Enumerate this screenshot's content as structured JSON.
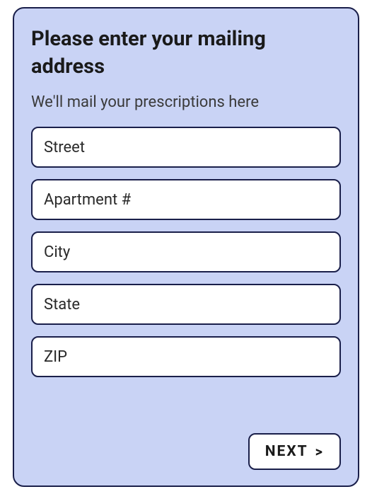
{
  "form": {
    "title": "Please enter your mailing address",
    "subtitle": "We'll mail your prescriptions here",
    "fields": {
      "street": {
        "placeholder": "Street",
        "value": ""
      },
      "apartment": {
        "placeholder": "Apartment #",
        "value": ""
      },
      "city": {
        "placeholder": "City",
        "value": ""
      },
      "state": {
        "placeholder": "State",
        "value": ""
      },
      "zip": {
        "placeholder": "ZIP",
        "value": ""
      }
    },
    "next_label": "NEXT",
    "next_chevron": ">"
  }
}
